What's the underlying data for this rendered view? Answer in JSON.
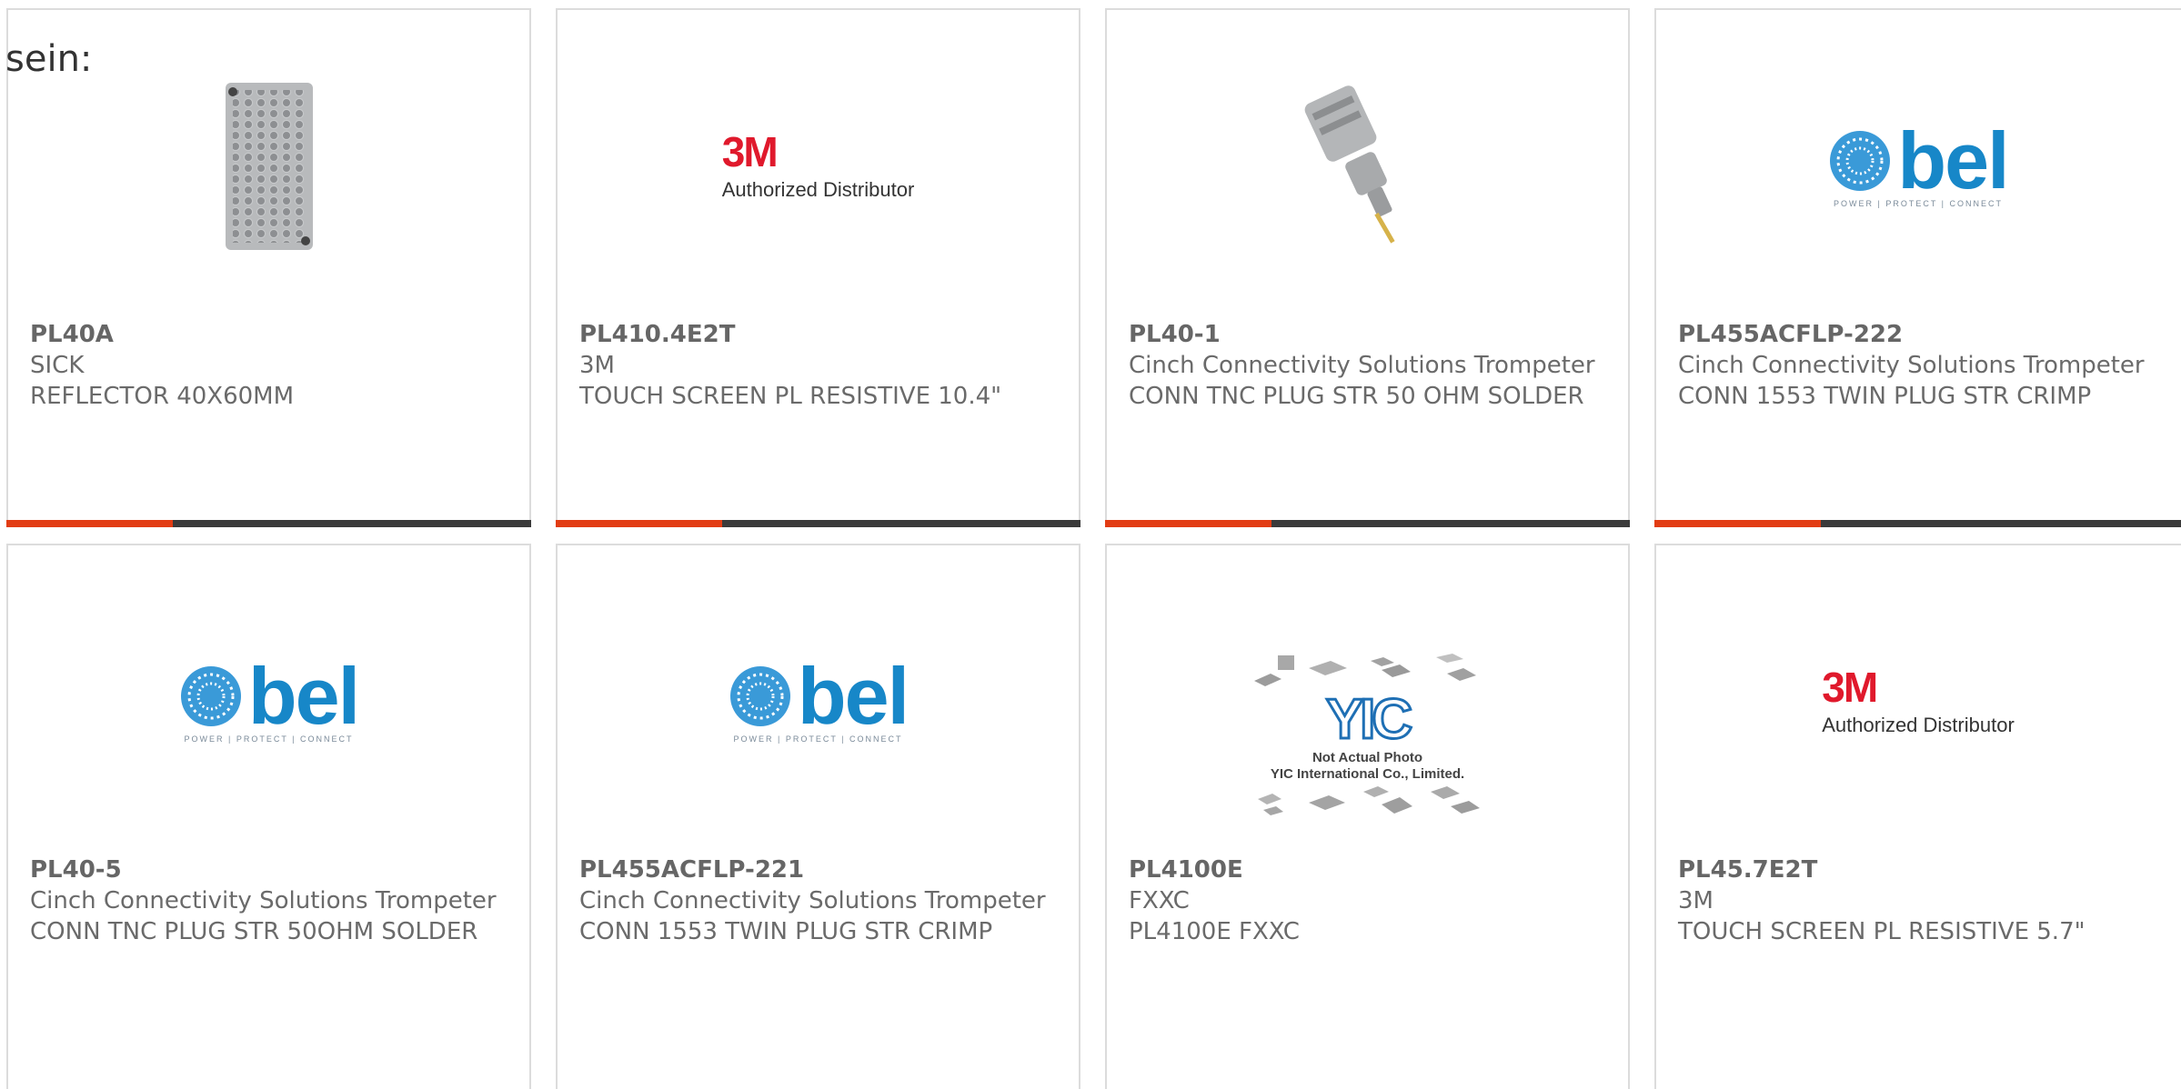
{
  "intro_text": "sein:",
  "colors": {
    "accent": "#e23c13",
    "bar": "#3a3a3a",
    "border": "#dcdcdc",
    "text": "#6a6a6a"
  },
  "products": [
    {
      "part": "PL40A",
      "maker": "SICK",
      "desc": "REFLECTOR 40X60MM",
      "image": "reflector-photo"
    },
    {
      "part": "PL410.4E2T",
      "maker": "3M",
      "desc": "TOUCH SCREEN PL RESISTIVE 10.4\"",
      "image": "3m-logo",
      "logo": {
        "mark": "3M",
        "sub": "Authorized Distributor"
      }
    },
    {
      "part": "PL40-1",
      "maker": "Cinch Connectivity Solutions Trompeter",
      "desc": "CONN TNC PLUG STR 50 OHM SOLDER",
      "image": "connector-photo"
    },
    {
      "part": "PL455ACFLP-222",
      "maker": "Cinch Connectivity Solutions Trompeter",
      "desc": "CONN 1553 TWIN PLUG STR CRIMP",
      "image": "bel-logo",
      "logo": {
        "word": "bel",
        "tag": "POWER | PROTECT | CONNECT"
      }
    },
    {
      "part": "PL40-5",
      "maker": "Cinch Connectivity Solutions Trompeter",
      "desc": "CONN TNC PLUG STR 50OHM SOLDER",
      "image": "bel-logo",
      "logo": {
        "word": "bel",
        "tag": "POWER | PROTECT | CONNECT"
      }
    },
    {
      "part": "PL455ACFLP-221",
      "maker": "Cinch Connectivity Solutions Trompeter",
      "desc": "CONN 1553 TWIN PLUG STR CRIMP",
      "image": "bel-logo",
      "logo": {
        "word": "bel",
        "tag": "POWER | PROTECT | CONNECT"
      }
    },
    {
      "part": "PL4100E",
      "maker": "FXXC",
      "desc": "PL4100E FXXC",
      "image": "yic-placeholder",
      "logo": {
        "mark": "YIC",
        "note1": "Not Actual Photo",
        "note2": "YIC International Co., Limited."
      }
    },
    {
      "part": "PL45.7E2T",
      "maker": "3M",
      "desc": "TOUCH SCREEN PL RESISTIVE 5.7\"",
      "image": "3m-logo",
      "logo": {
        "mark": "3M",
        "sub": "Authorized Distributor"
      }
    }
  ]
}
